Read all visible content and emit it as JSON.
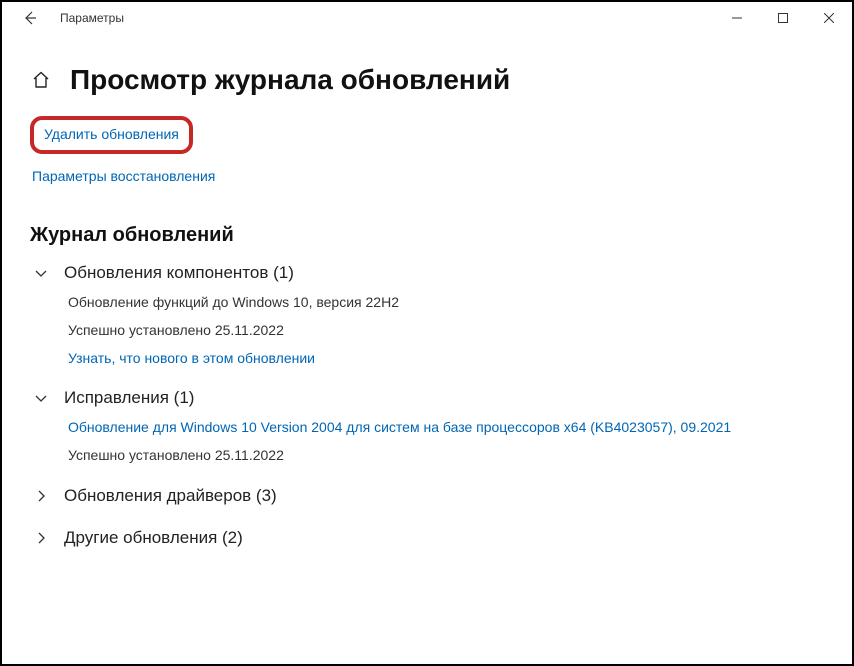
{
  "titlebar": {
    "back_icon": "←",
    "title": "Параметры"
  },
  "page": {
    "title": "Просмотр журнала обновлений",
    "uninstall_link": "Удалить обновления",
    "recovery_link": "Параметры восстановления",
    "history_heading": "Журнал обновлений"
  },
  "groups": {
    "components": {
      "title": "Обновления компонентов (1)",
      "line1": "Обновление функций до Windows 10, версия 22H2",
      "line2": "Успешно установлено 25.11.2022",
      "link": "Узнать, что нового в этом обновлении"
    },
    "fixes": {
      "title": "Исправления (1)",
      "link": "Обновление для Windows 10 Version 2004 для систем на базе процессоров x64 (KB4023057), 09.2021",
      "line2": "Успешно установлено 25.11.2022"
    },
    "drivers": {
      "title": "Обновления драйверов (3)"
    },
    "other": {
      "title": "Другие обновления (2)"
    }
  }
}
